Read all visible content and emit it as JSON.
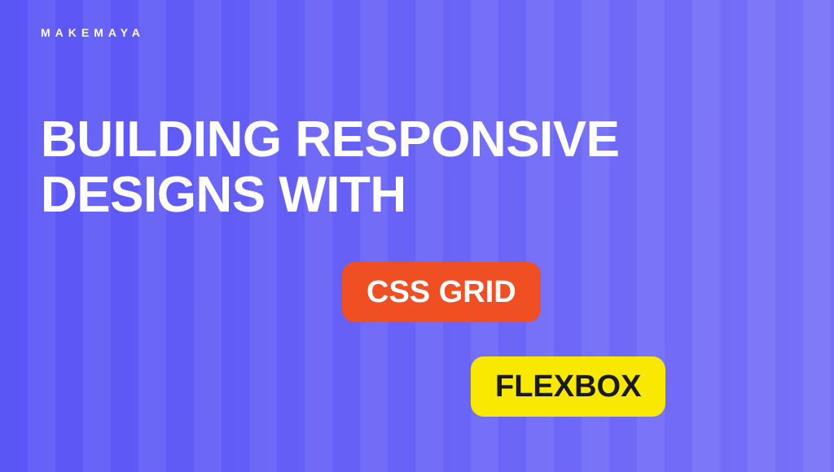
{
  "brand": "MAKEMAYA",
  "headline": "BUILDING RESPONSIVE DESIGNS WITH",
  "badges": {
    "grid": "CSS GRID",
    "flex": "FLEXBOX"
  },
  "colors": {
    "bg_start": "#5a55f5",
    "bg_end": "#7770f8",
    "badge_grid_bg": "#f04e23",
    "badge_grid_fg": "#ffffff",
    "badge_flex_bg": "#f9e900",
    "badge_flex_fg": "#1a1a1a"
  }
}
